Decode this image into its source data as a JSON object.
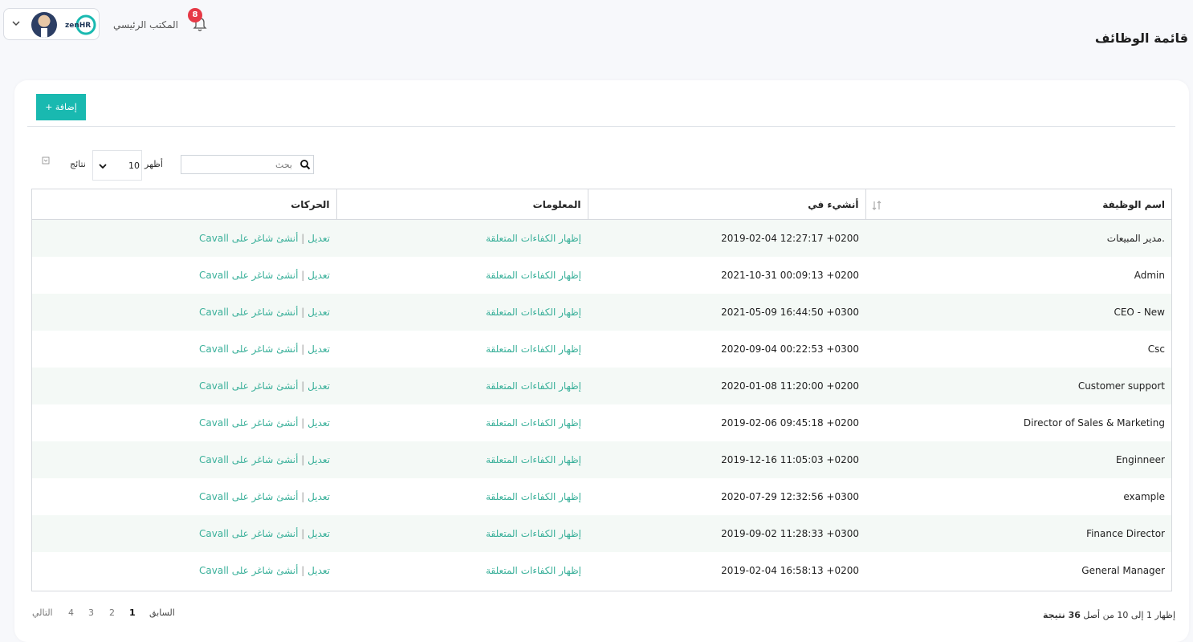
{
  "header": {
    "office": "المكتب الرئيسي",
    "notifications_count": "8",
    "logo_text": "zenHR",
    "brand_color": "#19b9b0"
  },
  "page": {
    "title": "قائمة الوظائف"
  },
  "toolbar": {
    "add_label": "+ إضافة"
  },
  "filters": {
    "search_placeholder": "بحث",
    "show_label": "أظهر",
    "page_length": "10",
    "results_label": "نتائج"
  },
  "table": {
    "headers": {
      "job_name": "اسم الوظيفة",
      "created_at": "أنشيء في",
      "info": "المعلومات",
      "actions": "الحركات"
    },
    "rows": [
      {
        "name": ".مدير المبيعات",
        "created": "2019-02-04 12:27:17 +0200",
        "info": "إظهار الكفاءات المتعلقة",
        "edit": "تعديل",
        "create": "أنشئ شاغر على Cavall"
      },
      {
        "name": "Admin",
        "created": "2021-10-31 00:09:13 +0200",
        "info": "إظهار الكفاءات المتعلقة",
        "edit": "تعديل",
        "create": "أنشئ شاغر على Cavall"
      },
      {
        "name": "CEO - New",
        "created": "2021-05-09 16:44:50 +0300",
        "info": "إظهار الكفاءات المتعلقة",
        "edit": "تعديل",
        "create": "أنشئ شاغر على Cavall"
      },
      {
        "name": "Csc",
        "created": "2020-09-04 00:22:53 +0300",
        "info": "إظهار الكفاءات المتعلقة",
        "edit": "تعديل",
        "create": "أنشئ شاغر على Cavall"
      },
      {
        "name": "Customer support",
        "created": "2020-01-08 11:20:00 +0200",
        "info": "إظهار الكفاءات المتعلقة",
        "edit": "تعديل",
        "create": "أنشئ شاغر على Cavall"
      },
      {
        "name": "Director of Sales & Marketing",
        "created": "2019-02-06 09:45:18 +0200",
        "info": "إظهار الكفاءات المتعلقة",
        "edit": "تعديل",
        "create": "أنشئ شاغر على Cavall"
      },
      {
        "name": "Enginneer",
        "created": "2019-12-16 11:05:03 +0200",
        "info": "إظهار الكفاءات المتعلقة",
        "edit": "تعديل",
        "create": "أنشئ شاغر على Cavall"
      },
      {
        "name": "example",
        "created": "2020-07-29 12:32:56 +0300",
        "info": "إظهار الكفاءات المتعلقة",
        "edit": "تعديل",
        "create": "أنشئ شاغر على Cavall"
      },
      {
        "name": "Finance Director",
        "created": "2019-09-02 11:28:33 +0300",
        "info": "إظهار الكفاءات المتعلقة",
        "edit": "تعديل",
        "create": "أنشئ شاغر على Cavall"
      },
      {
        "name": "General Manager",
        "created": "2019-02-04 16:58:13 +0200",
        "info": "إظهار الكفاءات المتعلقة",
        "edit": "تعديل",
        "create": "أنشئ شاغر على Cavall"
      }
    ]
  },
  "footer": {
    "info_prefix": "إظهار 1 إلى 10 من أصل",
    "info_total": "36 نتيجة",
    "prev": "السابق",
    "next": "التالي",
    "pages": [
      "1",
      "2",
      "3",
      "4"
    ],
    "current_page": "1"
  }
}
